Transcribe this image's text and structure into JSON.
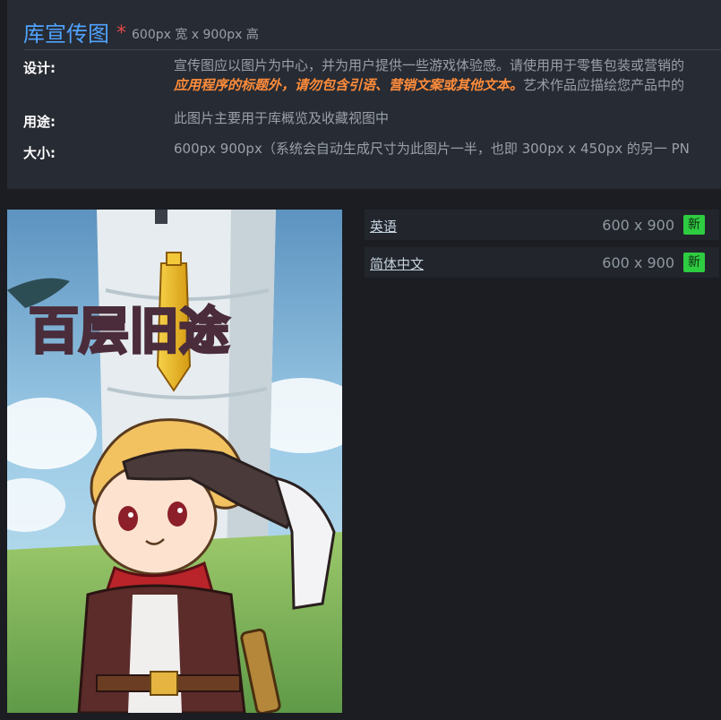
{
  "header": {
    "title": "库宣传图",
    "required_mark": "*",
    "dimensions_note": "600px 宽 x 900px 高"
  },
  "spec_rows": {
    "design": {
      "label": "设计:",
      "line1": "宣传图应以图片为中心，并为用户提供一些游戏体验感。请使用用于零售包装或营销的",
      "line2_emphasis": "应用程序的标题外，请勿包含引语、营销文案或其他文本。",
      "line2_rest": "艺术作品应描绘您产品中的"
    },
    "usage": {
      "label": "用途:",
      "value": "此图片主要用于库概览及收藏视图中"
    },
    "size": {
      "label": "大小:",
      "value": "600px 900px（系统会自动生成尺寸为此图片一半，也即 300px x 450px 的另一 PN"
    }
  },
  "artwork": {
    "logo_text": "百层旧途"
  },
  "languages": [
    {
      "name": "英语",
      "size": "600 x 900",
      "badge": "新"
    },
    {
      "name": "简体中文",
      "size": "600 x 900",
      "badge": "新"
    }
  ],
  "colors": {
    "title_blue": "#4fa3ff",
    "required_red": "#e04848",
    "emphasis_orange": "#ff8c3a",
    "badge_green": "#2ecc40",
    "page_bg": "#1b1d22",
    "panel_bg": "#272b33"
  }
}
